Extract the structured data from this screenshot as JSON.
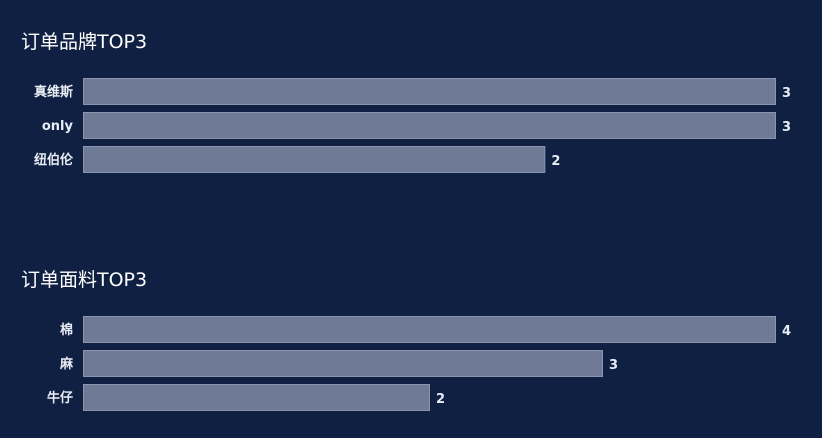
{
  "chart_data": [
    {
      "type": "bar",
      "orientation": "horizontal",
      "title": "订单品牌TOP3",
      "categories": [
        "真维斯",
        "only",
        "纽伯伦"
      ],
      "values": [
        3,
        3,
        2
      ],
      "xlim": [
        0,
        3
      ],
      "grid": false,
      "bar_color": "#6e7a96"
    },
    {
      "type": "bar",
      "orientation": "horizontal",
      "title": "订单面料TOP3",
      "categories": [
        "棉",
        "麻",
        "牛仔"
      ],
      "values": [
        4,
        3,
        2
      ],
      "xlim": [
        0,
        4
      ],
      "grid": false,
      "bar_color": "#6e7a96"
    }
  ],
  "background": "#102042"
}
